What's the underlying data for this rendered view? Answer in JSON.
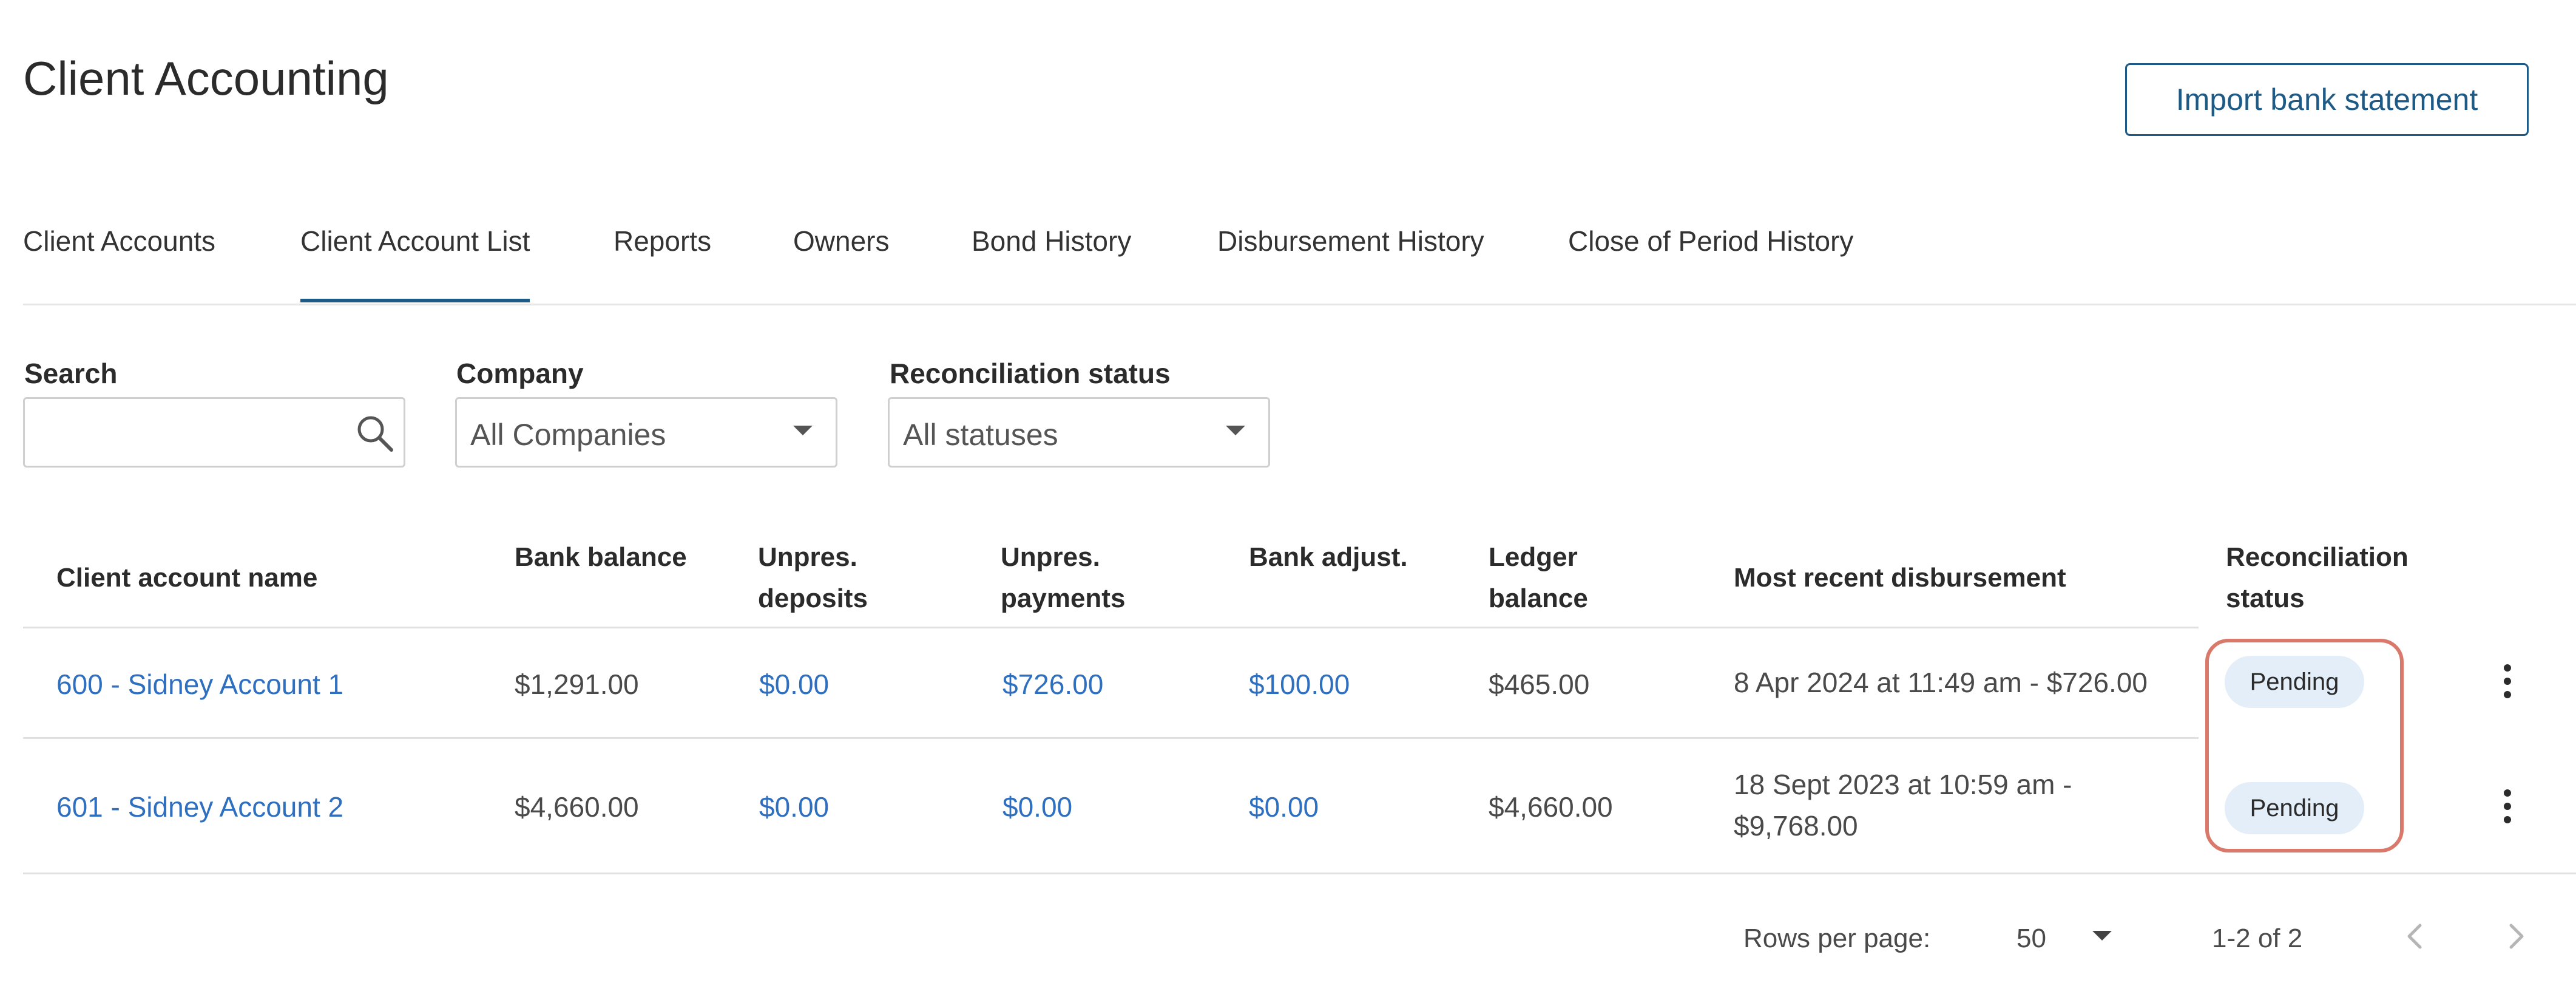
{
  "page": {
    "title": "Client Accounting",
    "import_button_label": "Import bank statement"
  },
  "tabs": [
    {
      "label": "Client Accounts",
      "active": false
    },
    {
      "label": "Client Account List",
      "active": true
    },
    {
      "label": "Reports",
      "active": false
    },
    {
      "label": "Owners",
      "active": false
    },
    {
      "label": "Bond History",
      "active": false
    },
    {
      "label": "Disbursement History",
      "active": false
    },
    {
      "label": "Close of Period History",
      "active": false
    }
  ],
  "filters": {
    "search": {
      "label": "Search",
      "value": "",
      "placeholder": "",
      "icon": "search-icon"
    },
    "company": {
      "label": "Company",
      "value": "All Companies",
      "icon": "chevron-down-icon"
    },
    "reconciliation": {
      "label": "Reconciliation status",
      "value": "All statuses",
      "icon": "chevron-down-icon"
    }
  },
  "table": {
    "columns": [
      [
        "Client account name"
      ],
      [
        "Bank balance"
      ],
      [
        "Unpres.",
        "deposits"
      ],
      [
        "Unpres.",
        "payments"
      ],
      [
        "Bank adjust."
      ],
      [
        "Ledger",
        "balance"
      ],
      [
        "Most recent disbursement"
      ],
      [
        "Reconciliation",
        "status"
      ]
    ],
    "rows": [
      {
        "name": "600 - Sidney Account 1",
        "bank_balance": "$1,291.00",
        "unpres_deposits": "$0.00",
        "unpres_payments": "$726.00",
        "bank_adjust": "$100.00",
        "ledger_balance": "$465.00",
        "recent_disbursement": [
          "8 Apr 2024 at 11:49 am - $726.00"
        ],
        "status": "Pending"
      },
      {
        "name": "601 - Sidney Account 2",
        "bank_balance": "$4,660.00",
        "unpres_deposits": "$0.00",
        "unpres_payments": "$0.00",
        "bank_adjust": "$0.00",
        "ledger_balance": "$4,660.00",
        "recent_disbursement": [
          "18 Sept 2023 at 10:59 am -",
          "$9,768.00"
        ],
        "status": "Pending"
      }
    ],
    "row_menu_icon": "more-vertical-icon"
  },
  "pagination": {
    "rows_per_page_label": "Rows per page:",
    "rows_per_page_value": "50",
    "range_text": "1-2 of 2",
    "prev_icon": "chevron-left-icon",
    "next_icon": "chevron-right-icon"
  },
  "colors": {
    "accent": "#1d5a86",
    "link": "#2f6fbf",
    "badge_bg": "#e3eef9",
    "highlight_outline": "#d9796c"
  }
}
